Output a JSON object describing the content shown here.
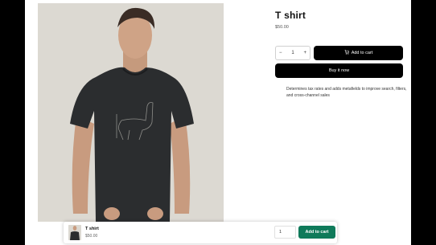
{
  "product": {
    "title": "T shirt",
    "price": "$50.00",
    "image_alt": "man wearing black t-shirt with llama print"
  },
  "quantity": {
    "minus": "−",
    "value": "1",
    "plus": "+"
  },
  "buttons": {
    "add_to_cart": "Add to cart",
    "buy_now": "Buy it now"
  },
  "description": "Determines tax rates and adds metafields to improve search, filters, and cross-channel sales",
  "sticky_bar": {
    "title": "T shirt",
    "price": "$50.00",
    "quantity": "1",
    "add_to_cart": "Add to cart",
    "button_color": "#0f7a5a"
  },
  "colors": {
    "backdrop": "#000000",
    "primary_button": "#000000",
    "accent": "#0f7a5a"
  },
  "icons": {
    "cart": "cart-icon"
  }
}
